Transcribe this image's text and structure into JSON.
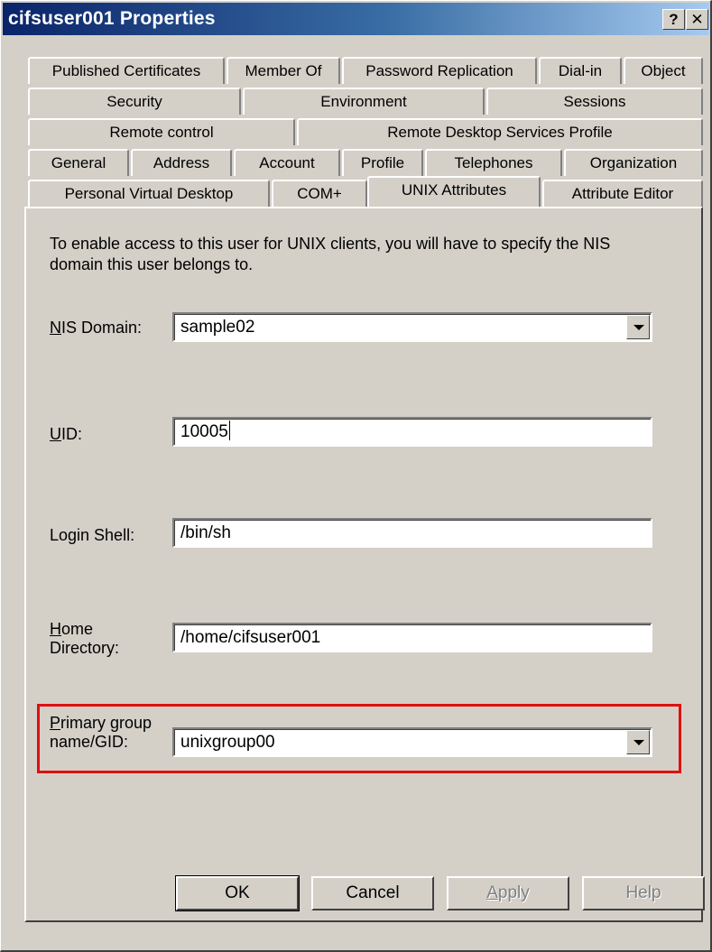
{
  "window": {
    "title": "cifsuser001 Properties",
    "help_glyph": "?",
    "close_glyph": "✕"
  },
  "tabs": {
    "row1": [
      "Published Certificates",
      "Member Of",
      "Password Replication",
      "Dial-in",
      "Object"
    ],
    "row2": [
      "Security",
      "Environment",
      "Sessions"
    ],
    "row3": [
      "Remote control",
      "Remote Desktop Services Profile"
    ],
    "row4": [
      "General",
      "Address",
      "Account",
      "Profile",
      "Telephones",
      "Organization"
    ],
    "row5": [
      "Personal Virtual Desktop",
      "COM+",
      "UNIX Attributes",
      "Attribute Editor"
    ],
    "active": "UNIX Attributes"
  },
  "panel": {
    "description": "To enable access to this user for UNIX clients, you will have to specify the NIS domain this user belongs to.",
    "nis_domain": {
      "label_first": "N",
      "label_rest": "IS Domain:",
      "value": "sample02"
    },
    "uid": {
      "label_first": "U",
      "label_rest": "ID:",
      "value": "10005"
    },
    "login_shell": {
      "label": "Login Shell:",
      "value": "/bin/sh"
    },
    "home_directory": {
      "label_first": "H",
      "label_line1_rest": "ome",
      "label_line2": "Directory:",
      "value": "/home/cifsuser001"
    },
    "primary_group": {
      "label_first": "P",
      "label_line1_rest": "rimary group",
      "label_line2": "name/GID:",
      "value": "unixgroup00"
    }
  },
  "buttons": {
    "ok": "OK",
    "cancel": "Cancel",
    "apply_first": "A",
    "apply_rest": "pply",
    "help": "Help"
  },
  "colors": {
    "highlight": "#e01010",
    "titlebar_start": "#0a246a"
  }
}
